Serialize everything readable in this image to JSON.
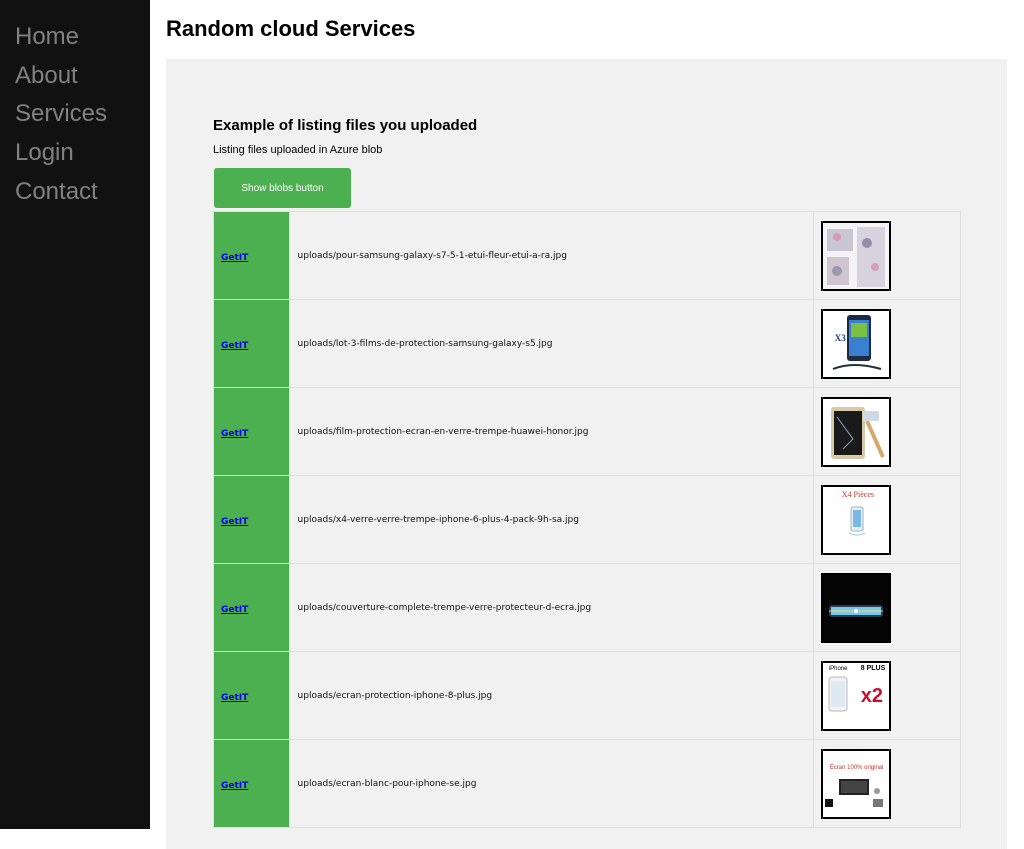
{
  "nav": {
    "items": [
      "Home",
      "About",
      "Services",
      "Login",
      "Contact"
    ]
  },
  "page": {
    "title": "Random cloud Services"
  },
  "section": {
    "title": "Example of listing files you uploaded",
    "description": "Listing files uploaded in Azure blob",
    "button_label": "Show blobs button"
  },
  "files": [
    {
      "link_label": "GetIT",
      "name": "uploads/pour-samsung-galaxy-s7-5-1-etui-fleur-etui-a-ra.jpg"
    },
    {
      "link_label": "GetIT",
      "name": "uploads/lot-3-films-de-protection-samsung-galaxy-s5.jpg"
    },
    {
      "link_label": "GetIT",
      "name": "uploads/film-protection-ecran-en-verre-trempe-huawei-honor.jpg"
    },
    {
      "link_label": "GetIT",
      "name": "uploads/x4-verre-verre-trempe-iphone-6-plus-4-pack-9h-sa.jpg"
    },
    {
      "link_label": "GetIT",
      "name": "uploads/couverture-complete-trempe-verre-protecteur-d-ecra.jpg"
    },
    {
      "link_label": "GetIT",
      "name": "uploads/ecran-protection-iphone-8-plus.jpg"
    },
    {
      "link_label": "GetIT",
      "name": "uploads/ecran-blanc-pour-iphone-se.jpg"
    }
  ],
  "thumb_text": {
    "t2_mark": "X3",
    "t4_label": "X4 Pièces",
    "t6_brand": "iPhone",
    "t6_model": "8 PLUS",
    "t6_count": "x2",
    "t7_label": "Écran 100% original"
  },
  "colors": {
    "sidebar_bg": "#111111",
    "nav_text": "#818181",
    "accent_green": "#4caf50",
    "panel_bg": "#f1f1f1",
    "link": "#0000ee"
  }
}
